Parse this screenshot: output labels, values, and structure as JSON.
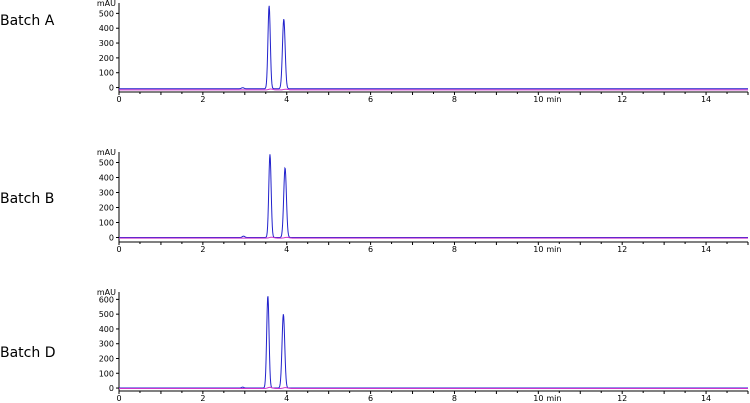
{
  "chart_data": [
    {
      "type": "line",
      "label": "Batch A",
      "y_unit": "mAU",
      "x_unit": "min",
      "xlim": [
        0,
        15
      ],
      "ylim": [
        -30,
        570
      ],
      "x_ticks": [
        0,
        2,
        4,
        6,
        8,
        10,
        12,
        14
      ],
      "y_ticks": [
        0,
        100,
        200,
        300,
        400,
        500
      ],
      "series": [
        {
          "color": "#2222cc",
          "baseline": -8,
          "peaks": [
            {
              "x": 3.58,
              "y": 560,
              "w": 0.028
            },
            {
              "x": 3.93,
              "y": 470,
              "w": 0.032
            }
          ],
          "minor": [
            {
              "x": 2.95,
              "y": 7,
              "w": 0.03
            }
          ]
        },
        {
          "color": "#cc33cc",
          "baseline": -16,
          "peaks": [
            {
              "x": 3.62,
              "y": 6,
              "w": 0.05
            },
            {
              "x": 3.98,
              "y": 5,
              "w": 0.05
            }
          ],
          "minor": []
        }
      ]
    },
    {
      "type": "line",
      "label": "Batch B",
      "y_unit": "mAU",
      "x_unit": "min",
      "xlim": [
        0,
        15
      ],
      "ylim": [
        -30,
        570
      ],
      "x_ticks": [
        0,
        2,
        4,
        6,
        8,
        10,
        12,
        14
      ],
      "y_ticks": [
        0,
        100,
        200,
        300,
        400,
        500
      ],
      "series": [
        {
          "color": "#2222cc",
          "baseline": 0,
          "peaks": [
            {
              "x": 3.6,
              "y": 555,
              "w": 0.028
            },
            {
              "x": 3.96,
              "y": 465,
              "w": 0.032
            }
          ],
          "minor": [
            {
              "x": 2.97,
              "y": 9,
              "w": 0.03
            }
          ]
        },
        {
          "color": "#cc33cc",
          "baseline": -4,
          "peaks": [
            {
              "x": 3.64,
              "y": 6,
              "w": 0.05
            },
            {
              "x": 4.0,
              "y": 5,
              "w": 0.05
            }
          ],
          "minor": []
        }
      ]
    },
    {
      "type": "line",
      "label": "Batch D",
      "y_unit": "mAU",
      "x_unit": "min",
      "xlim": [
        0,
        15
      ],
      "ylim": [
        -20,
        650
      ],
      "x_ticks": [
        0,
        2,
        4,
        6,
        8,
        10,
        12,
        14
      ],
      "y_ticks": [
        0,
        100,
        200,
        300,
        400,
        500,
        600
      ],
      "series": [
        {
          "color": "#2222cc",
          "baseline": 0,
          "peaks": [
            {
              "x": 3.55,
              "y": 625,
              "w": 0.028
            },
            {
              "x": 3.92,
              "y": 500,
              "w": 0.032
            }
          ],
          "minor": [
            {
              "x": 2.95,
              "y": 6,
              "w": 0.03
            }
          ]
        },
        {
          "color": "#cc33cc",
          "baseline": -3,
          "peaks": [
            {
              "x": 3.6,
              "y": 8,
              "w": 0.05
            },
            {
              "x": 3.97,
              "y": 6,
              "w": 0.05
            }
          ],
          "minor": []
        }
      ]
    }
  ]
}
